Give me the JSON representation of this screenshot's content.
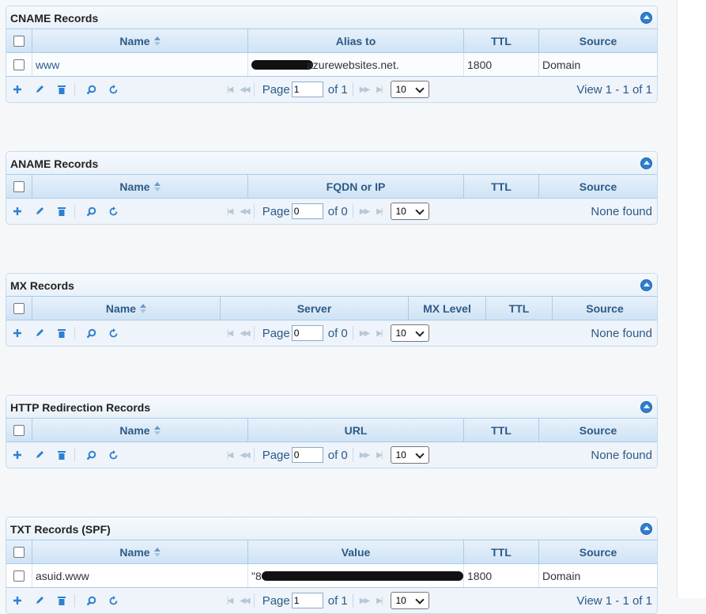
{
  "pager": {
    "page_label": "Page",
    "rows_option": "10",
    "tools": [
      "add-icon",
      "edit-icon",
      "delete-icon",
      "search-icon",
      "refresh-icon"
    ]
  },
  "cname": {
    "title": "CNAME Records",
    "columns": [
      "Name",
      "Alias to",
      "TTL",
      "Source"
    ],
    "rows": [
      {
        "name": "www",
        "value": "azurewebsites.net.",
        "ttl": "1800",
        "source": "Domain"
      }
    ],
    "page": "1",
    "of": "of 1",
    "view": "View 1 - 1 of 1"
  },
  "aname": {
    "title": "ANAME Records",
    "columns": [
      "Name",
      "FQDN or IP",
      "TTL",
      "Source"
    ],
    "page": "0",
    "of": "of 0",
    "view": "None found"
  },
  "mx": {
    "title": "MX Records",
    "columns": [
      "Name",
      "Server",
      "MX Level",
      "TTL",
      "Source"
    ],
    "page": "0",
    "of": "of 0",
    "view": "None found"
  },
  "http": {
    "title": "HTTP Redirection Records",
    "columns": [
      "Name",
      "URL",
      "TTL",
      "Source"
    ],
    "page": "0",
    "of": "of 0",
    "view": "None found"
  },
  "txt": {
    "title": "TXT Records (SPF)",
    "columns": [
      "Name",
      "Value",
      "TTL",
      "Source"
    ],
    "rows": [
      {
        "name": "asuid.www",
        "value": "\"8",
        "ttl": "1800",
        "source": "Domain"
      }
    ],
    "page": "1",
    "of": "of 1",
    "view": "View 1 - 1 of 1"
  }
}
